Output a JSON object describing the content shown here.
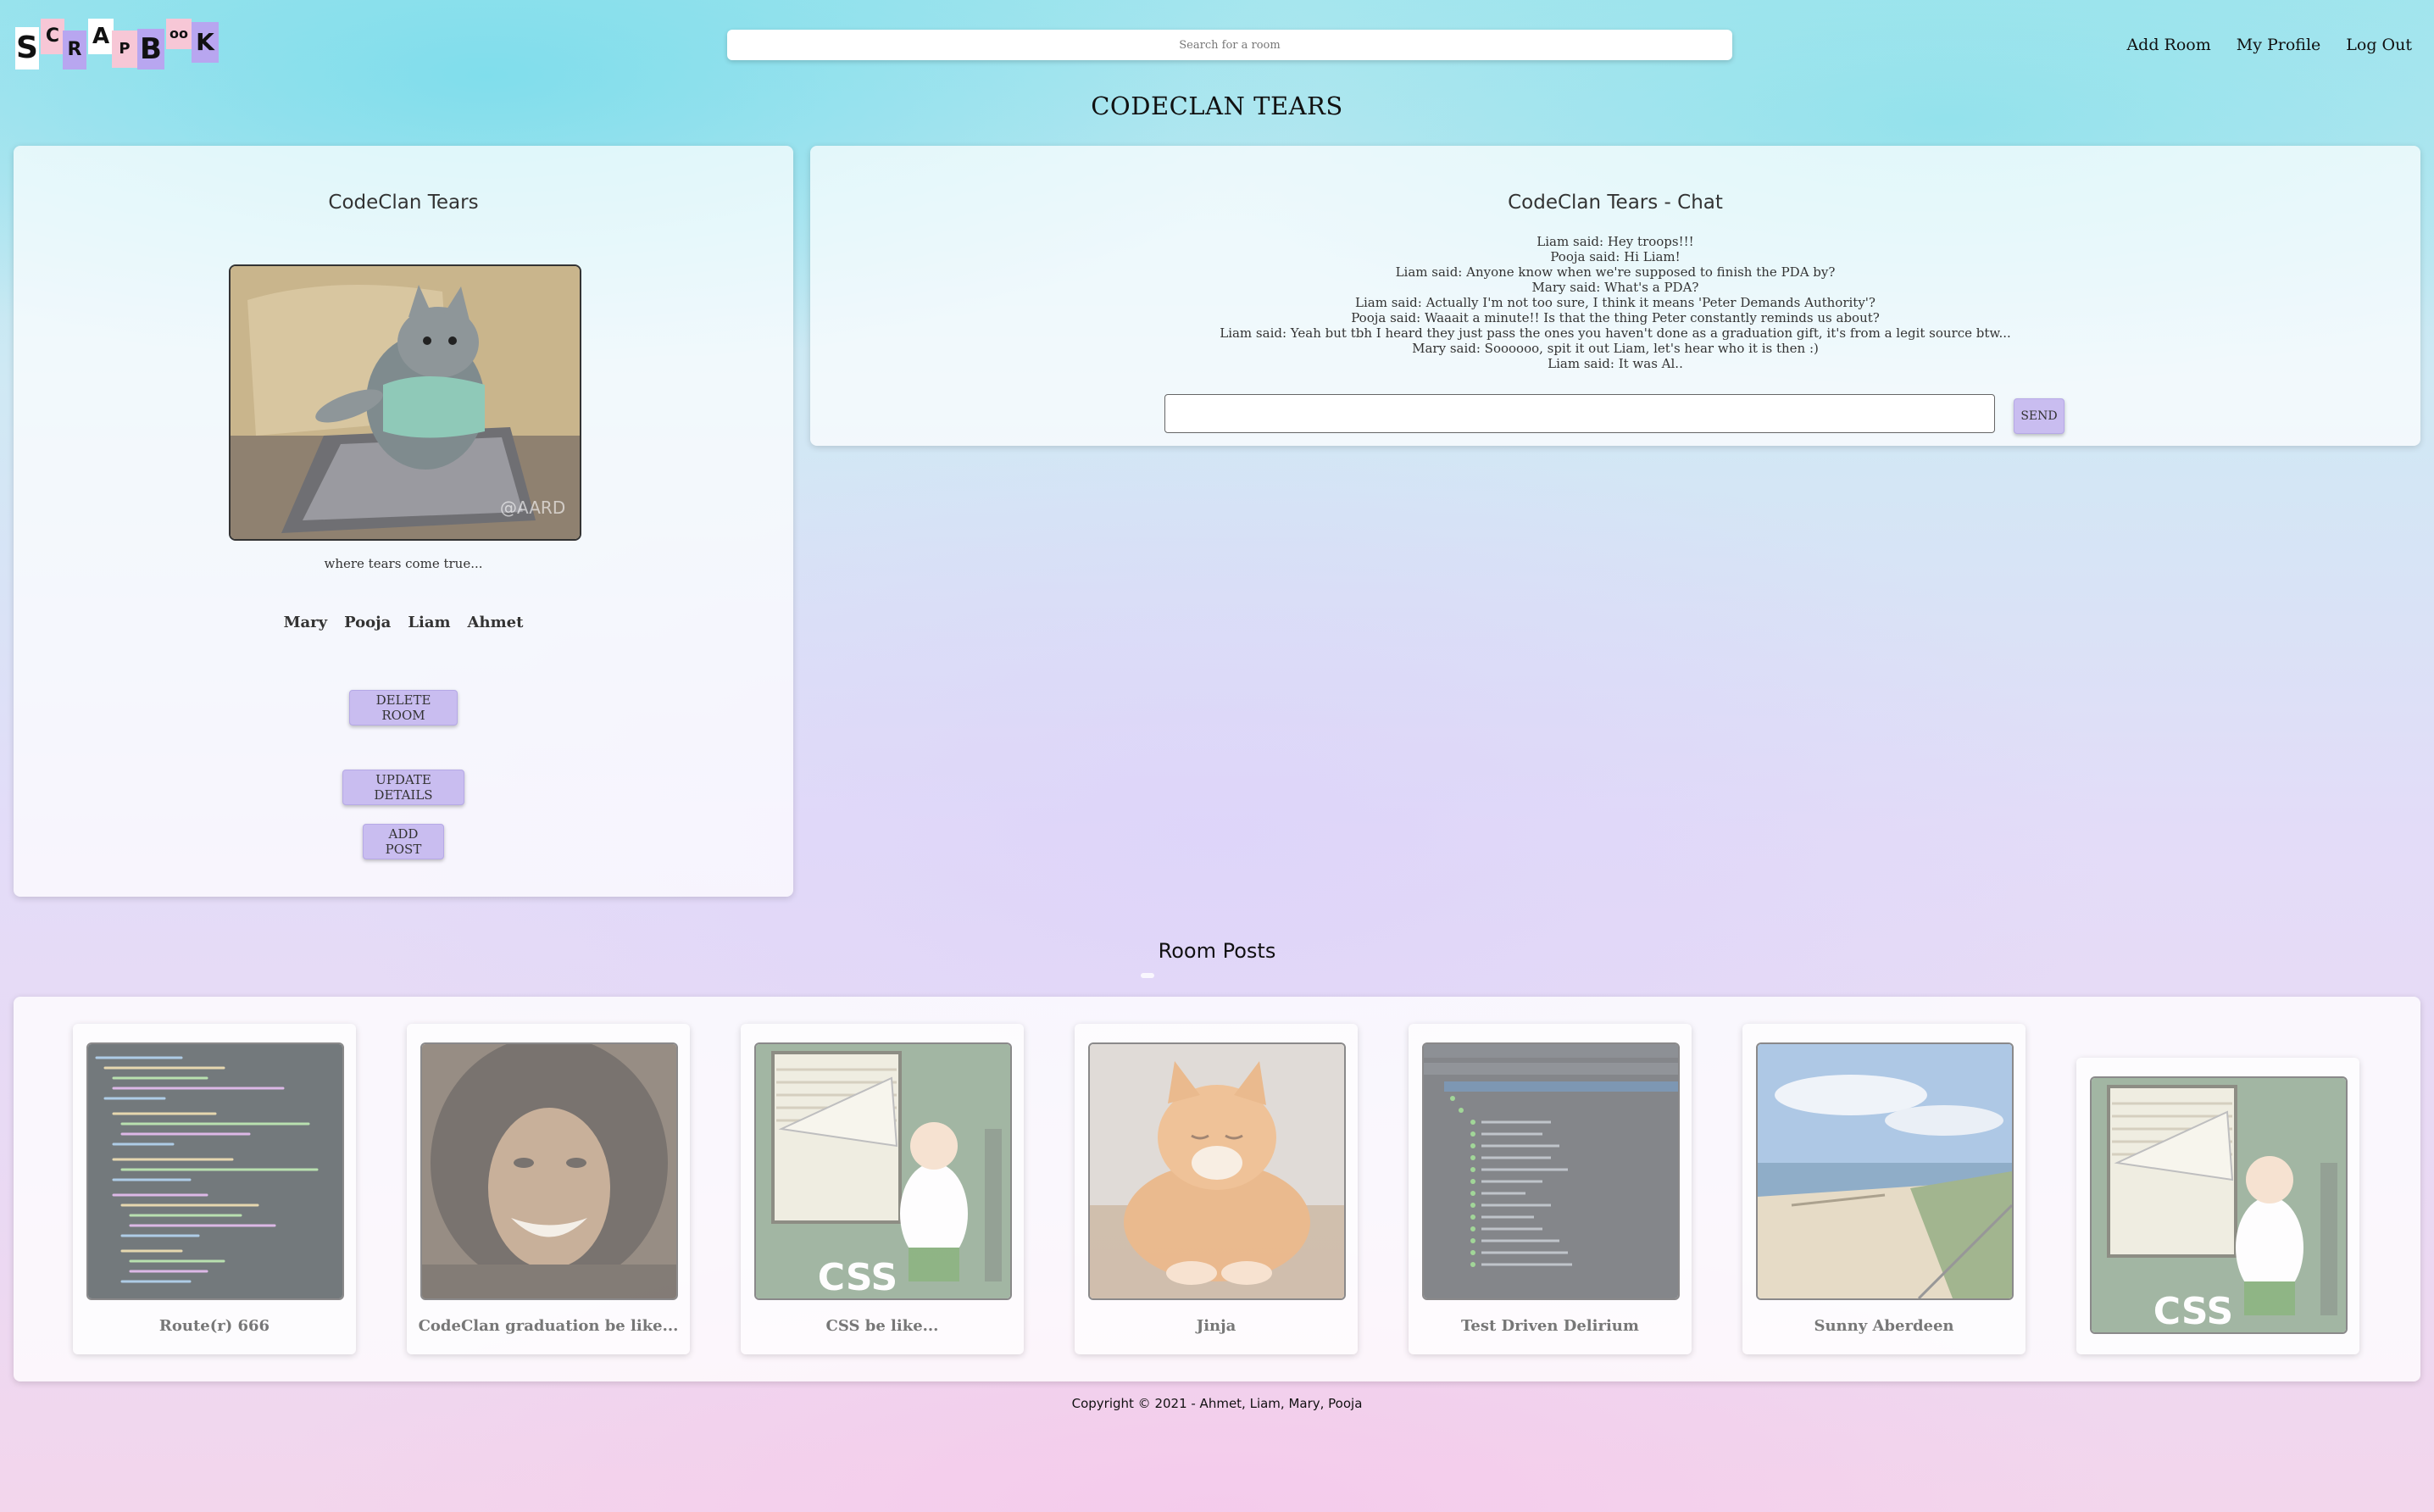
{
  "header": {
    "logo_letters": [
      "S",
      "C",
      "R",
      "A",
      "P",
      "B",
      "oo",
      "K"
    ],
    "logo_colors": [
      "#f7c7d6",
      "#b8a6f0",
      "#f7c7d6",
      "#b8a6f0",
      "#f7c7d6",
      "#b8a6f0",
      "#f7c7d6",
      "#b8a6f0"
    ],
    "search_placeholder": "Search for a room",
    "nav": {
      "add_room": "Add Room",
      "my_profile": "My Profile",
      "log_out": "Log Out"
    }
  },
  "page_title": "CODECLAN TEARS",
  "room": {
    "name": "CodeClan Tears",
    "image_icon": "cat-typing-laptop-image",
    "image_watermark": "@AARD",
    "description": "where tears come true...",
    "members": [
      "Mary",
      "Pooja",
      "Liam",
      "Ahmet"
    ],
    "buttons": {
      "delete": "DELETE ROOM",
      "update": "UPDATE DETAILS",
      "add_post": "ADD POST"
    }
  },
  "chat": {
    "title": "CodeClan Tears - Chat",
    "messages": [
      "Liam said: Hey troops!!!",
      "Pooja said: Hi Liam!",
      "Liam said: Anyone know when we're supposed to finish the PDA by?",
      "Mary said: What's a PDA?",
      "Liam said: Actually I'm not too sure, I think it means 'Peter Demands Authority'?",
      "Pooja said: Waaait a minute!! Is that the thing Peter constantly reminds us about?",
      "Liam said: Yeah but tbh I heard they just pass the ones you haven't done as a graduation gift, it's from a legit source btw...",
      "Mary said: Soooooo, spit it out Liam, let's hear who it is then :)",
      "Liam said: It was Al.."
    ],
    "input_value": "",
    "send_label": "SEND"
  },
  "posts": {
    "heading": "Room Posts",
    "items": [
      {
        "caption": "Route(r) 666",
        "icon": "code-screenshot-image"
      },
      {
        "caption": "CodeClan graduation be like...",
        "icon": "laughing-man-image"
      },
      {
        "caption": "CSS be like...",
        "icon": "css-cartoon-blinds-image"
      },
      {
        "caption": "Jinja",
        "icon": "ginger-cat-image"
      },
      {
        "caption": "Test Driven Delirium",
        "icon": "test-results-screenshot-image"
      },
      {
        "caption": "Sunny Aberdeen",
        "icon": "beach-image"
      },
      {
        "caption": "",
        "icon": "css-cartoon-blinds-image"
      }
    ],
    "css_overlay_text": "CSS"
  },
  "footer": "Copyright © 2021 - Ahmet, Liam, Mary, Pooja"
}
